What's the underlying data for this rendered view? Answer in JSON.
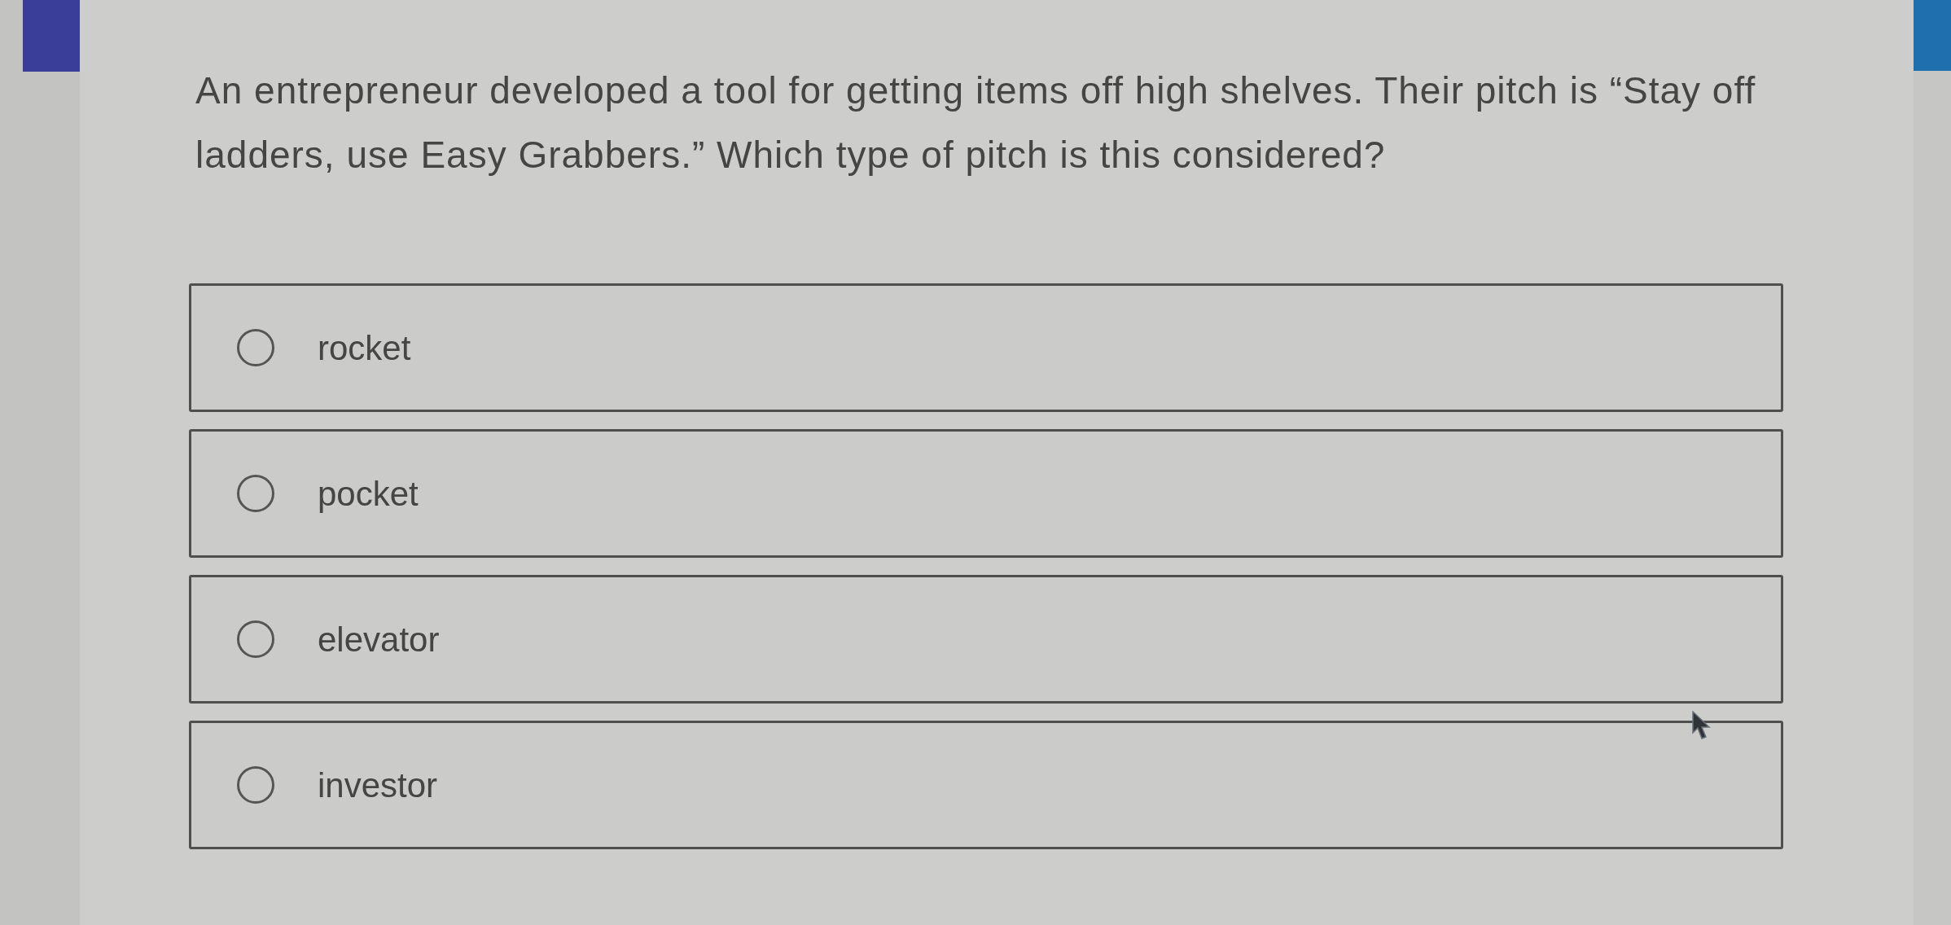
{
  "question": {
    "text": "An entrepreneur developed a tool for getting items off high shelves. Their pitch is “Stay off ladders, use Easy Grabbers.” Which type of pitch is this considered?"
  },
  "options": [
    {
      "label": "rocket",
      "selected": false
    },
    {
      "label": "pocket",
      "selected": false
    },
    {
      "label": "elevator",
      "selected": false
    },
    {
      "label": "investor",
      "selected": false
    }
  ]
}
